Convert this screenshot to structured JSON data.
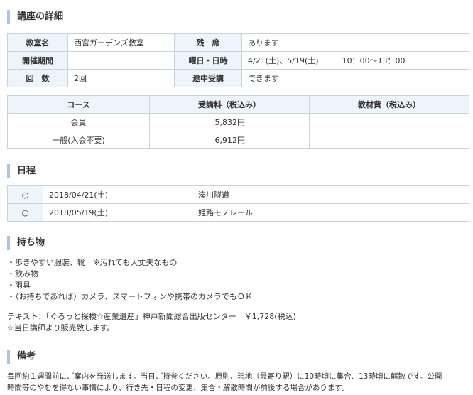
{
  "details": {
    "heading": "講座の詳細",
    "rows": [
      {
        "l1": "教室名",
        "v1": "西宮ガーデンズ教室",
        "l2": "残　席",
        "v2": "あります"
      },
      {
        "l1": "開催期間",
        "v1": "",
        "l2": "曜日・日時",
        "v2": "4/21(土)、5/19(土)　　　10：00〜13：00"
      },
      {
        "l1": "回　数",
        "v1": "2回",
        "l2": "途中受講",
        "v2": "できます"
      }
    ]
  },
  "fees": {
    "headers": [
      "コース",
      "受講料（税込み）",
      "教材費（税込み）"
    ],
    "rows": [
      {
        "course": "会員",
        "fee": "5,832円",
        "material": ""
      },
      {
        "course": "一般(入会不要)",
        "fee": "6,912円",
        "material": ""
      }
    ]
  },
  "schedule": {
    "heading": "日程",
    "rows": [
      {
        "mark": "○",
        "date": "2018/04/21(土)",
        "place": "湊川隧道"
      },
      {
        "mark": "○",
        "date": "2018/05/19(土)",
        "place": "姫路モノレール"
      }
    ]
  },
  "belongings": {
    "heading": "持ち物",
    "items": [
      "・歩きやすい服装、靴　※汚れても大丈夫なもの",
      "・飲み物",
      "・雨具",
      "・（お持ちであれば）カメラ、スマートフォンや携帯のカメラでもＯＫ"
    ],
    "text1": "テキスト：「ぐるっと探検☆産業遺産」神戸新聞総合出版センター　￥1,728(税込)",
    "text2": "☆当日講師より販売致します。"
  },
  "notes": {
    "heading": "備考",
    "line1": "毎回約１週間前にご案内を発送します。当日ご持参ください。原則、現地（最寄り駅）に10時頃に集合、13時頃に解散です。公開",
    "line2": "時間等のやむを得ない事情により、行き先・日程の変更、集合・解散時間が前後する場合があります。"
  }
}
